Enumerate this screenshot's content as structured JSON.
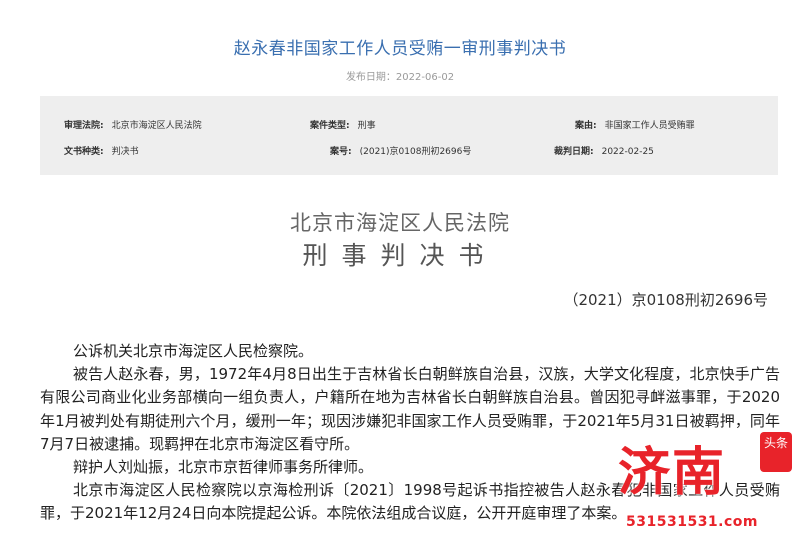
{
  "header": {
    "title": "赵永春非国家工作人员受贿一审刑事判决书",
    "publish_date": "发布日期：2022-06-02"
  },
  "meta": {
    "court_label": "审理法院:",
    "court_value": "北京市海淀区人民法院",
    "case_type_label": "案件类型:",
    "case_type_value": "刑事",
    "cause_label": "案由:",
    "cause_value": "非国家工作人员受贿罪",
    "doc_type_label": "文书种类:",
    "doc_type_value": "判决书",
    "case_no_label": "案号:",
    "case_no_value": "(2021)京0108刑初2696号",
    "date_label": "裁判日期:",
    "date_value": "2022-02-25"
  },
  "document": {
    "court_name": "北京市海淀区人民法院",
    "doc_title": "刑事判决书",
    "doc_number": "（2021）京0108刑初2696号",
    "paragraphs": [
      "公诉机关北京市海淀区人民检察院。",
      "被告人赵永春，男，1972年4月8日出生于吉林省长白朝鲜族自治县，汉族，大学文化程度，北京快手广告有限公司商业化业务部横向一组负责人，户籍所在地为吉林省长白朝鲜族自治县。曾因犯寻衅滋事罪，于2020年1月被判处有期徒刑六个月，缓刑一年；现因涉嫌犯非国家工作人员受贿罪，于2021年5月31日被羁押，同年7月7日被逮捕。现羁押在北京市海淀区看守所。",
      "辩护人刘灿振，北京市京哲律师事务所律师。",
      "北京市海淀区人民检察院以京海检刑诉〔2021〕1998号起诉书指控被告人赵永春犯非国家工作人员受贿罪，于2021年12月24日向本院提起公诉。本院依法组成合议庭，公开开庭审理了本案。"
    ]
  },
  "watermark": {
    "brand_chars": "济南",
    "badge_text": "头条",
    "phone": "531531531.com"
  }
}
